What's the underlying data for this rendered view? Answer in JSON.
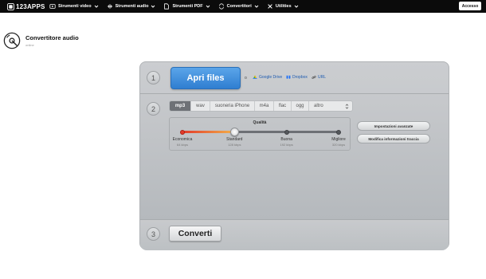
{
  "topbar": {
    "brand": "123APPS",
    "nav": [
      {
        "label": "Strumenti video",
        "icon": "video-icon"
      },
      {
        "label": "Strumenti audio",
        "icon": "audio-icon"
      },
      {
        "label": "Strumenti PDF",
        "icon": "pdf-icon"
      },
      {
        "label": "Convertitori",
        "icon": "convert-icon"
      },
      {
        "label": "Utilities",
        "icon": "tools-icon"
      }
    ],
    "login_label": "Accesso"
  },
  "app": {
    "title": "Convertitore audio",
    "subtitle": "online"
  },
  "step1": {
    "number": "1",
    "open_label": "Apri files",
    "or_label": "o",
    "sources": [
      {
        "label": "Google Drive",
        "icon": "google-drive-icon"
      },
      {
        "label": "Dropbox",
        "icon": "dropbox-icon"
      },
      {
        "label": "URL",
        "icon": "link-icon"
      }
    ]
  },
  "step2": {
    "number": "2",
    "formats": [
      "mp3",
      "wav",
      "suoneria iPhone",
      "m4a",
      "flac",
      "ogg",
      "altro"
    ],
    "selected_format": "mp3",
    "quality": {
      "label": "Qualità",
      "selected_index": 1,
      "options": [
        {
          "name": "Economica",
          "bitrate": "64 kbps"
        },
        {
          "name": "Standard",
          "bitrate": "128 kbps"
        },
        {
          "name": "Buona",
          "bitrate": "192 kbps"
        },
        {
          "name": "Migliore",
          "bitrate": "320 kbps"
        }
      ]
    },
    "advanced_label": "Impostazioni avanzate",
    "edit_info_label": "Modifica informazioni traccia"
  },
  "step3": {
    "number": "3",
    "convert_label": "Converti"
  },
  "colors": {
    "primary_blue": "#2f7ed1",
    "slider_red": "#e23a2a",
    "slider_orange": "#f3b04a",
    "link_blue": "#1e5bb0"
  }
}
